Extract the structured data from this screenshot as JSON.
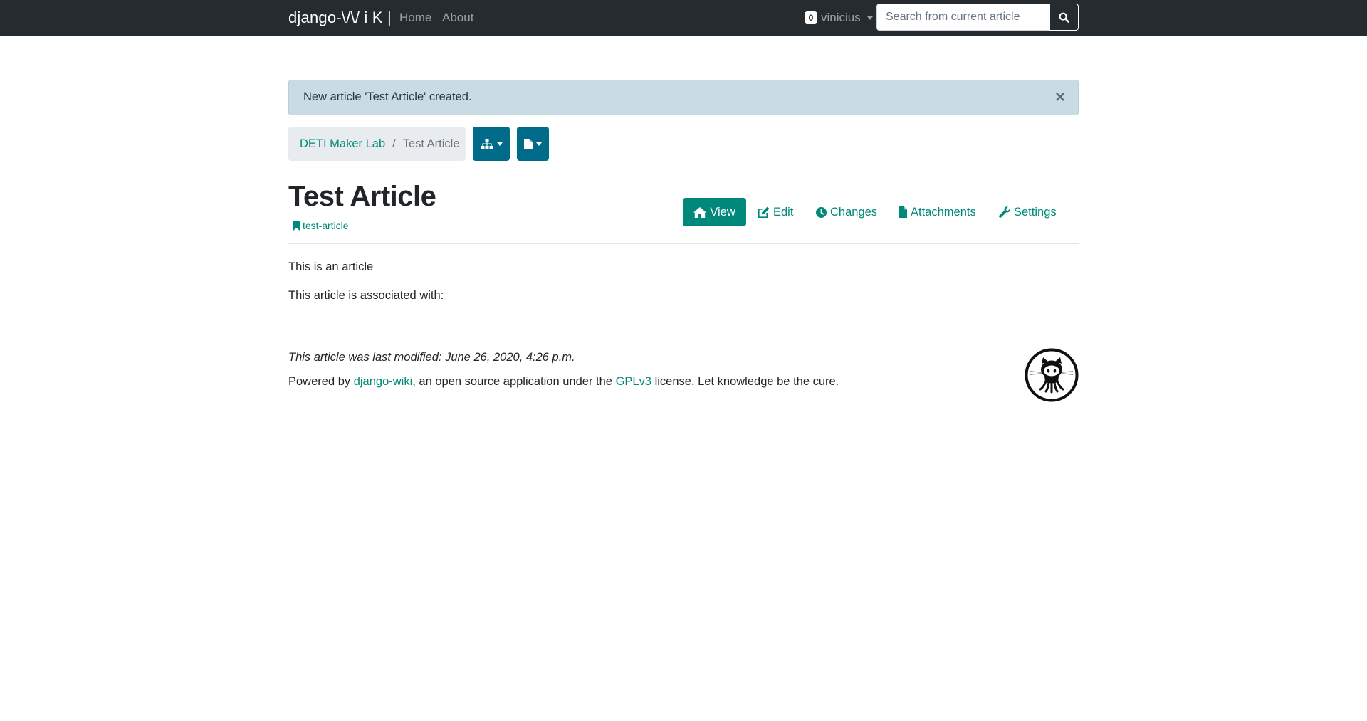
{
  "navbar": {
    "brand": "django-\\/\\/ i K |",
    "links": [
      {
        "label": "Home"
      },
      {
        "label": "About"
      }
    ],
    "user": {
      "badge_count": "0",
      "name": "vinicius"
    },
    "search": {
      "placeholder": "Search from current article"
    }
  },
  "alert": {
    "message": "New article 'Test Article' created.",
    "close_label": "×"
  },
  "breadcrumb": {
    "items": [
      {
        "label": "DETI Maker Lab"
      },
      {
        "label": "Test Article"
      }
    ],
    "separator": "/"
  },
  "article": {
    "title": "Test Article",
    "slug": "test-article",
    "tabs": [
      {
        "label": "View",
        "active": true,
        "icon": "home-icon"
      },
      {
        "label": "Edit",
        "icon": "edit-icon"
      },
      {
        "label": "Changes",
        "icon": "clock-icon"
      },
      {
        "label": "Attachments",
        "icon": "file-icon"
      },
      {
        "label": "Settings",
        "icon": "wrench-icon"
      }
    ],
    "body": [
      "This is an article",
      "This article is associated with:"
    ]
  },
  "footer": {
    "last_modified": "This article was last modified: June 26, 2020, 4:26 p.m.",
    "powered_prefix": "Powered by ",
    "powered_link": "django-wiki",
    "powered_middle": ", an open source application under the ",
    "license_link": "GPLv3",
    "powered_suffix": " license. Let knowledge be the cure."
  },
  "colors": {
    "navbar_bg": "#262b30",
    "accent": "#00897b",
    "tool_button": "#006c8a",
    "alert_bg": "#c9dce3"
  }
}
